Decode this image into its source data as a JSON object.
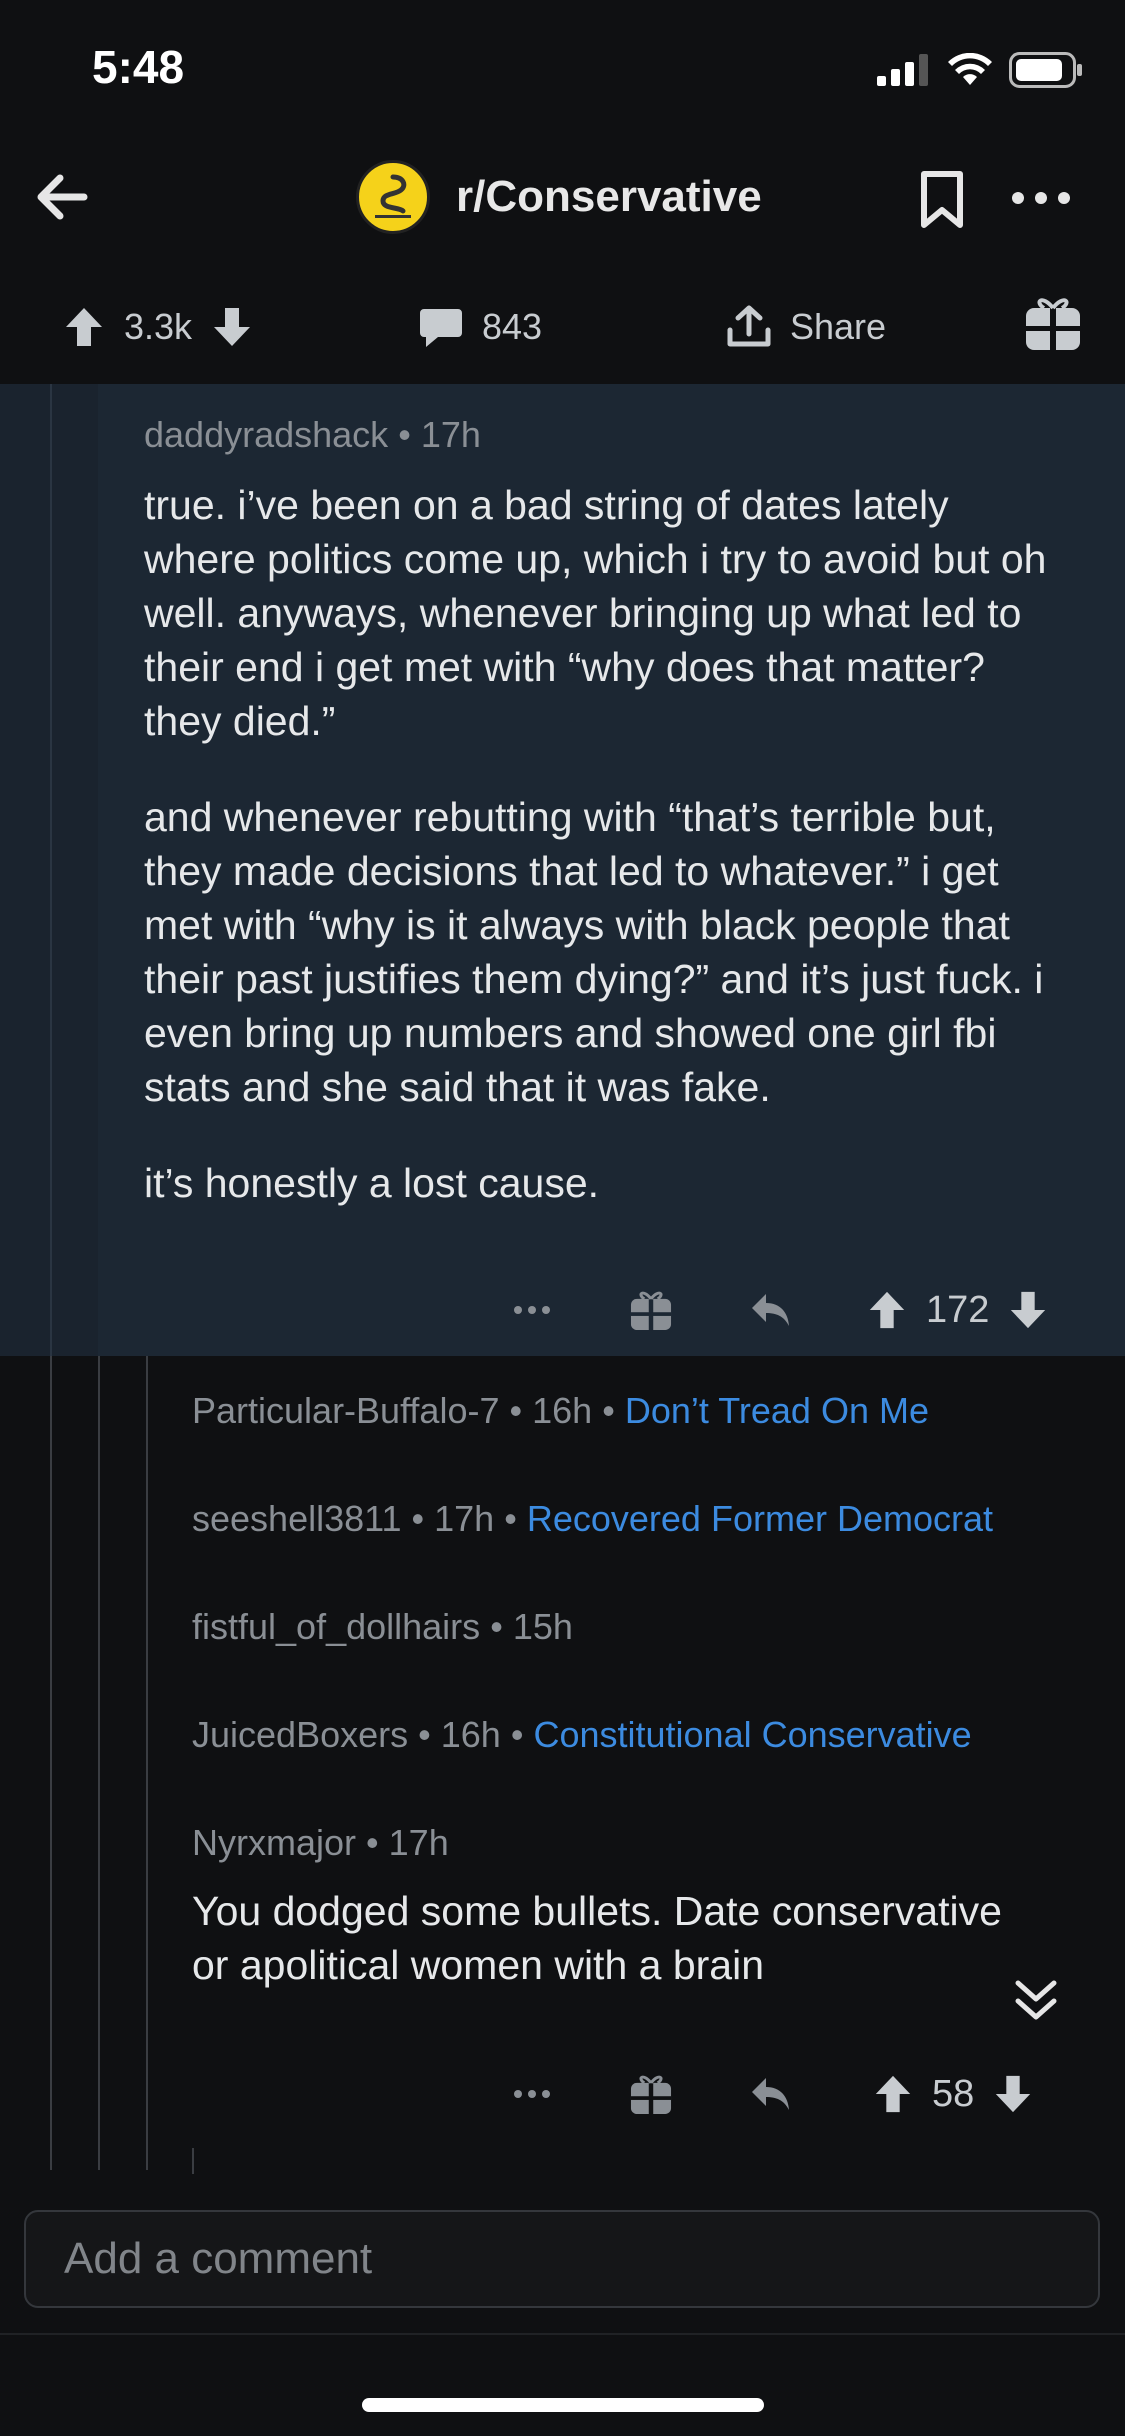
{
  "status_bar": {
    "time": "5:48"
  },
  "header": {
    "subreddit": "r/Conservative"
  },
  "post_actions": {
    "upvotes": "3.3k",
    "comments": "843",
    "share_label": "Share"
  },
  "highlighted_comment": {
    "author": "daddyradshack",
    "separator": "•",
    "age": "17h",
    "paragraphs": [
      "true. i’ve been on a bad string of dates lately where politics come up, which i try to avoid but oh well. anyways, whenever bringing up what led to their end i get met with “why does that matter? they died.”",
      "and whenever rebutting with “that’s terrible but, they made decisions that led to whatever.” i get met with “why is it always with black people that their past justifies them dying?” and it’s just fuck. i even bring up numbers and showed one girl fbi stats and she said that it was fake.",
      "it’s honestly a lost cause."
    ],
    "score": "172"
  },
  "collapsed_comments": [
    {
      "author": "Particular-Buffalo-7",
      "separator": "•",
      "age": "16h",
      "flair": "Don’t Tread On Me"
    },
    {
      "author": "seeshell3811",
      "separator": "•",
      "age": "17h",
      "flair": "Recovered Former Democrat"
    },
    {
      "author": "fistful_of_dollhairs",
      "separator": "•",
      "age": "15h",
      "flair": ""
    },
    {
      "author": "JuicedBoxers",
      "separator": "•",
      "age": "16h",
      "flair": "Constitutional Conservative"
    }
  ],
  "reply_comment": {
    "author": "Nyrxmajor",
    "separator": "•",
    "age": "17h",
    "body": "You dodged some bullets. Date conservative or apolitical women with a brain",
    "score": "58"
  },
  "comment_input": {
    "placeholder": "Add a comment"
  },
  "colors": {
    "background": "#0f1012",
    "highlight": "#1c2733",
    "flair": "#3c8be0"
  },
  "icons": [
    "back-arrow-icon",
    "subreddit-avatar",
    "bookmark-icon",
    "more-icon",
    "upvote-icon",
    "downvote-icon",
    "comment-icon",
    "share-icon",
    "gift-icon",
    "reply-icon",
    "chevron-double-down-icon"
  ]
}
